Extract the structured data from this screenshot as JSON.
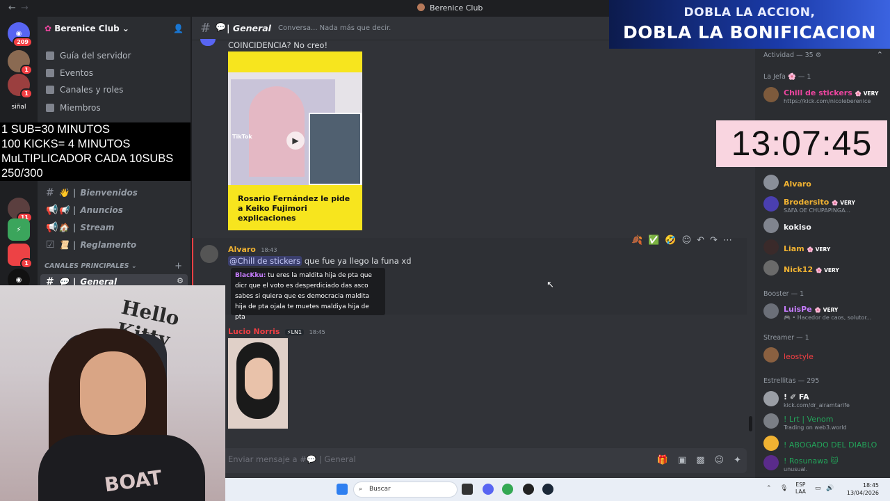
{
  "window": {
    "title": "Berenice Club",
    "back": "←",
    "forward": "→"
  },
  "promo": {
    "line1": "DOBLA LA ACCION,",
    "line2": "DOBLA LA BONIFICACION"
  },
  "guilds": {
    "home_badge": "209",
    "badges": [
      "1",
      "1",
      "11",
      "1"
    ],
    "signal_label": "siñal"
  },
  "server": {
    "name": "Berenice Club",
    "menu": [
      "Guía del servidor",
      "Eventos",
      "Canales y roles",
      "Miembros"
    ],
    "category": "CANALES PRINCIPALES",
    "channels": [
      "Bienvenidos",
      "Anuncios",
      "Stream",
      "Reglamento",
      "General"
    ]
  },
  "overlay": {
    "lines": [
      "1 SUB=30 MINUTOS",
      "100 KICKS= 4 MINUTOS",
      "MuLTIPLICADOR CADA 10SUBS",
      "250/300"
    ]
  },
  "webcam": {
    "wall_text": "Hello Kitty",
    "shirt_text": "BOAT"
  },
  "channel": {
    "name": "General",
    "topic": "Conversa... Nada más que decir."
  },
  "messages": {
    "m1_text": "COINCIDENCIA? No creo!",
    "tiktok_brand": "TikTok",
    "tiktok_caption": "Rosario Fernández le pide a Keiko Fujimori explicaciones",
    "m2_author": "Alvaro",
    "m2_time": "18:43",
    "m2_mention": "@Chill de stickers",
    "m2_text": "que fue ya llego la funa xd",
    "quote_author": "BlacKku:",
    "quote_text": "tu eres la maldita hija de pta que dicr que el voto es desperdiciado das asco sabes si quiera que es democracia maldita hija de pta ojala te muetes maldiya hija de pta",
    "m3_author": "Lucio Norris",
    "m3_badge": "LN1",
    "m3_time": "18:45"
  },
  "input": {
    "placeholder": "Enviar mensaje a #💬 | General"
  },
  "members": {
    "activity": "Actividad — 35",
    "sections": {
      "jefa": "La Jefa 🌸 — 1",
      "booster": "Booster — 1",
      "streamer": "Streamer — 1",
      "estrellitas": "Estrellitas — 295"
    },
    "jefa": {
      "name": "Chill de stickers",
      "tag": "VERY",
      "sub": "https://kick.com/nicoleberenice"
    },
    "list": [
      {
        "name": "Alvaro",
        "tag": "",
        "sub": "",
        "color": "#f0b232"
      },
      {
        "name": "Brodersito",
        "tag": "VERY",
        "sub": "SAFA OE CHUPAPINGA...",
        "color": "#f0b232"
      },
      {
        "name": "kokiso",
        "tag": "",
        "sub": "",
        "color": "#f2f3f5"
      },
      {
        "name": "Liam",
        "tag": "VERY",
        "sub": "",
        "color": "#f0b232"
      },
      {
        "name": "Nick12",
        "tag": "VERY",
        "sub": "",
        "color": "#f0b232"
      }
    ],
    "booster": {
      "name": "LuisPe",
      "tag": "VERY",
      "sub": "🎮 • Hacedor de caos, solutor...",
      "color": "#c77dff"
    },
    "streamer": {
      "name": "leostyle",
      "color": "#f23f43"
    },
    "estrellitas": [
      {
        "name": "! ✐ FA",
        "sub": "kick.com/dr_airamtarife",
        "color": "#f2f3f5"
      },
      {
        "name": "! Lrt | Venom",
        "sub": "Trading on web3.world",
        "color": "#23a55a"
      },
      {
        "name": "! ABOGADO DEL DIABLO",
        "sub": "",
        "color": "#23a55a"
      },
      {
        "name": "! Rosunawa 🐱",
        "sub": "unusual.",
        "color": "#23a55a"
      }
    ]
  },
  "timer": "13:07:45",
  "taskbar": {
    "search": "Buscar",
    "lang": "ESP",
    "lang2": "LAA",
    "time": "18:45",
    "date": "13/04/2026"
  },
  "colors": {
    "accent": "#5865f2",
    "link_red": "#f23f43",
    "yellow": "#f0b232"
  }
}
